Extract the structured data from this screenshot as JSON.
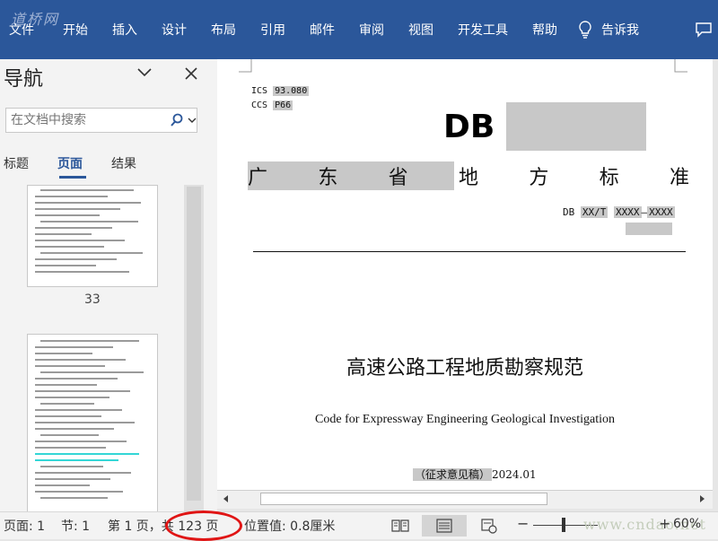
{
  "watermark_top": "道桥网",
  "ribbon": {
    "tabs": [
      "文件",
      "开始",
      "插入",
      "设计",
      "布局",
      "引用",
      "邮件",
      "审阅",
      "视图",
      "开发工具",
      "帮助"
    ],
    "tell_me": "告诉我"
  },
  "nav": {
    "title": "导航",
    "search_placeholder": "在文档中搜索",
    "tabs": [
      "标题",
      "页面",
      "结果"
    ],
    "active_tab": "页面",
    "thumb_page_label": "33"
  },
  "document": {
    "ics_label": "ICS",
    "ics_value": "93.080",
    "ccs_label": "CCS",
    "ccs_value": "P66",
    "logo": "DB",
    "standard_type": [
      "广",
      "东",
      "省",
      "地",
      "方",
      "标",
      "准"
    ],
    "std_prefix": "DB",
    "std_code": "XX/T",
    "std_no1": "XXXX",
    "std_sep": "—",
    "std_no2": "XXXX",
    "title_cn": "高速公路工程地质勘察规范",
    "title_en": "Code for Expressway Engineering Geological Investigation",
    "draft_label": "（征求意见稿）",
    "draft_date": "2024.01"
  },
  "status": {
    "page_section": "页面: 1",
    "section": "节: 1",
    "page_of": "第 1 页，共 123 页",
    "position": "位置值: 0.8厘米",
    "zoom": "60%",
    "watermark": "www.cndao.net"
  },
  "colors": {
    "ribbon": "#2b579a",
    "highlight": "#c8c8c8",
    "annotation": "#e01515"
  }
}
